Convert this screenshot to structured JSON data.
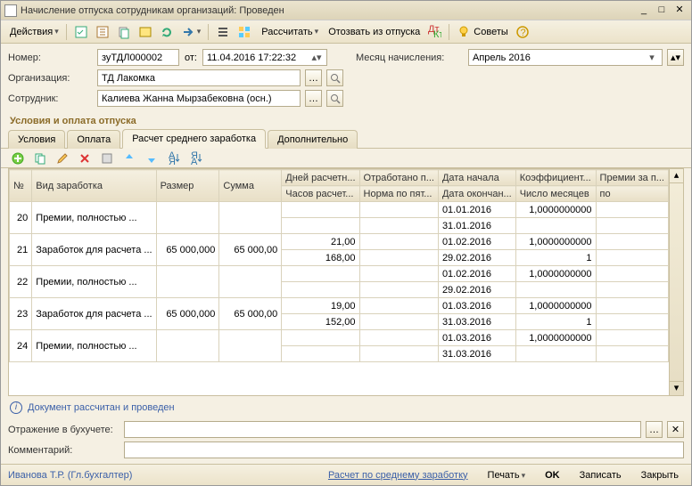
{
  "window": {
    "title": "Начисление отпуска сотрудникам организаций: Проведен"
  },
  "toolbar": {
    "actions": "Действия",
    "calculate": "Рассчитать",
    "recall": "Отозвать из отпуска",
    "advice": "Советы"
  },
  "form": {
    "number_label": "Номер:",
    "number_value": "зуТДЛ000002",
    "from_label": "от:",
    "date_value": "11.04.2016 17:22:32",
    "month_label": "Месяц начисления:",
    "month_value": "Апрель 2016",
    "org_label": "Организация:",
    "org_value": "ТД Лакомка",
    "emp_label": "Сотрудник:",
    "emp_value": "Калиева Жанна Мырзабековна  (осн.)"
  },
  "section_title": "Условия и оплата отпуска",
  "tabs": {
    "t1": "Условия",
    "t2": "Оплата",
    "t3": "Расчет среднего заработка",
    "t4": "Дополнительно"
  },
  "grid": {
    "headers": {
      "num": "№",
      "kind": "Вид заработка",
      "size": "Размер",
      "sum": "Сумма",
      "days": "Дней расчетн...",
      "hours": "Часов расчет...",
      "worked": "Отработано п...",
      "norm": "Норма по пят...",
      "dstart": "Дата начала",
      "dend": "Дата окончан...",
      "coef": "Коэффициент...",
      "months": "Число месяцев",
      "bonus": "Премии за п...",
      "po": "по"
    },
    "rows": [
      {
        "n": "20",
        "kind": "Премии, полностью ...",
        "size": "",
        "sum": "",
        "days": "",
        "hours": "",
        "worked": "",
        "norm": "",
        "d1": "01.01.2016",
        "d2": "31.01.2016",
        "coef": "1,0000000000",
        "months": ""
      },
      {
        "n": "21",
        "kind": "Заработок для расчета ...",
        "size": "65 000,000",
        "sum": "65 000,00",
        "days": "21,00",
        "hours": "168,00",
        "worked": "",
        "norm": "",
        "d1": "01.02.2016",
        "d2": "29.02.2016",
        "coef": "1,0000000000",
        "months": "1"
      },
      {
        "n": "22",
        "kind": "Премии, полностью ...",
        "size": "",
        "sum": "",
        "days": "",
        "hours": "",
        "worked": "",
        "norm": "",
        "d1": "01.02.2016",
        "d2": "29.02.2016",
        "coef": "1,0000000000",
        "months": ""
      },
      {
        "n": "23",
        "kind": "Заработок для расчета ...",
        "size": "65 000,000",
        "sum": "65 000,00",
        "days": "19,00",
        "hours": "152,00",
        "worked": "",
        "norm": "",
        "d1": "01.03.2016",
        "d2": "31.03.2016",
        "coef": "1,0000000000",
        "months": "1"
      },
      {
        "n": "24",
        "kind": "Премии, полностью ...",
        "size": "",
        "sum": "",
        "days": "",
        "hours": "",
        "worked": "",
        "norm": "",
        "d1": "01.03.2016",
        "d2": "31.03.2016",
        "coef": "1,0000000000",
        "months": ""
      }
    ]
  },
  "status_note": "Документ рассчитан и проведен",
  "bottom": {
    "account_label": "Отражение в бухучете:",
    "comment_label": "Комментарий:"
  },
  "footer": {
    "user": "Иванова Т.Р. (Гл.бухгалтер)",
    "avg": "Расчет по среднему заработку",
    "print": "Печать",
    "ok": "OK",
    "save": "Записать",
    "close": "Закрыть"
  }
}
